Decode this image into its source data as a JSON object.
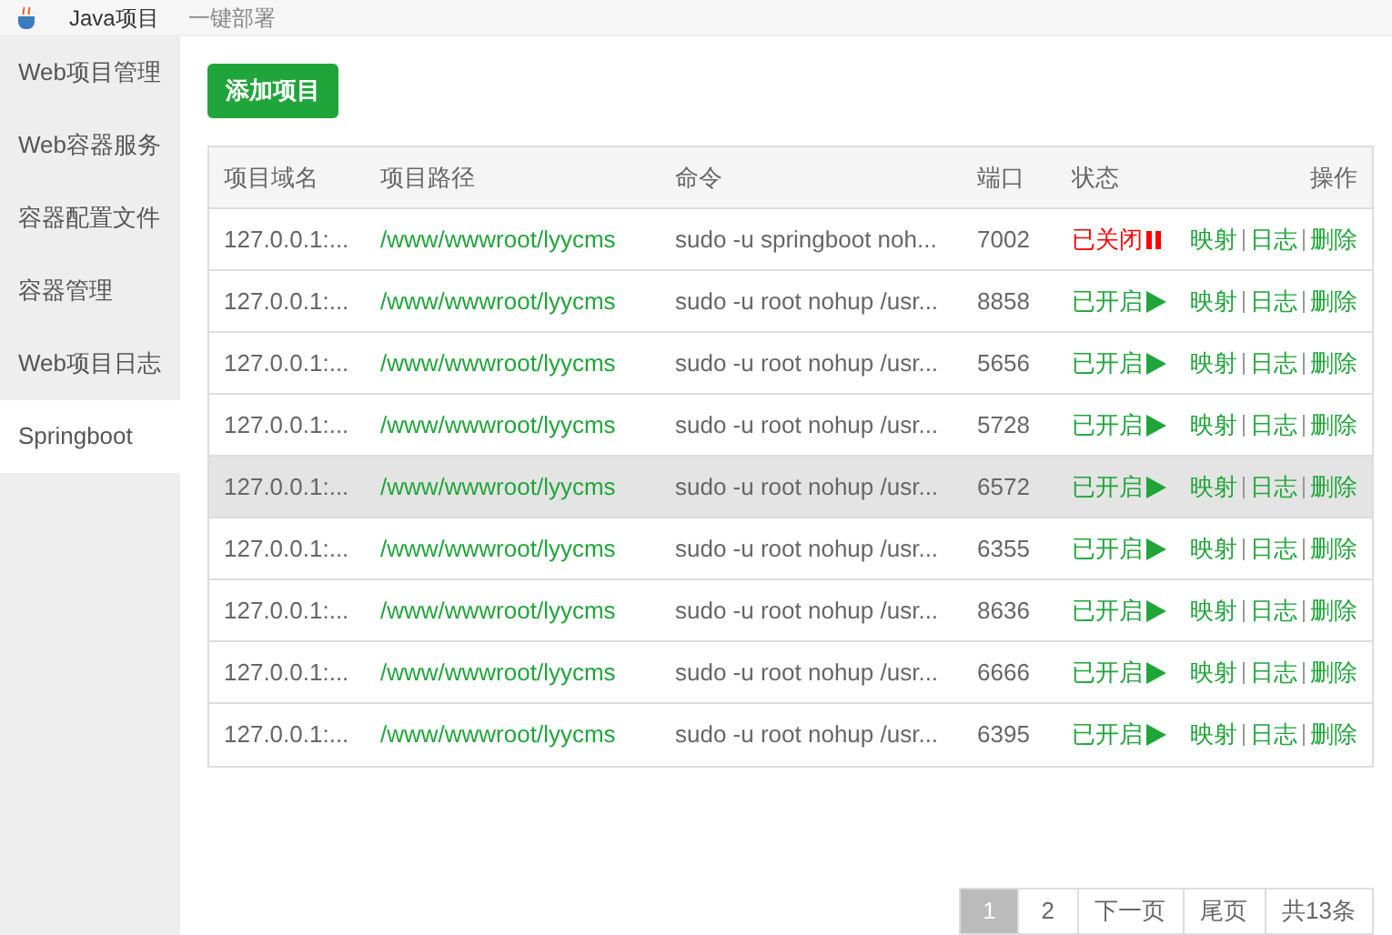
{
  "top_tabs": [
    {
      "label": "Java项目",
      "selected": true
    },
    {
      "label": "一键部署",
      "selected": false
    }
  ],
  "sidebar": {
    "items": [
      {
        "label": "Web项目管理",
        "selected": false
      },
      {
        "label": "Web容器服务",
        "selected": false
      },
      {
        "label": "容器配置文件",
        "selected": false
      },
      {
        "label": "容器管理",
        "selected": false
      },
      {
        "label": "Web项目日志",
        "selected": false
      },
      {
        "label": "Springboot",
        "selected": true
      }
    ]
  },
  "add_button": "添加项目",
  "table": {
    "columns": [
      "项目域名",
      "项目路径",
      "命令",
      "端口",
      "状态",
      "操作"
    ],
    "rows": [
      {
        "domain": "127.0.0.1:...",
        "path": "/www/wwwroot/lyycms",
        "command": "sudo -u springboot noh...",
        "port": "7002",
        "status": "已关闭",
        "running": false,
        "highlighted": false,
        "actions": [
          "映射",
          "日志",
          "删除"
        ]
      },
      {
        "domain": "127.0.0.1:...",
        "path": "/www/wwwroot/lyycms",
        "command": "sudo -u root nohup /usr...",
        "port": "8858",
        "status": "已开启",
        "running": true,
        "highlighted": false,
        "actions": [
          "映射",
          "日志",
          "删除"
        ]
      },
      {
        "domain": "127.0.0.1:...",
        "path": "/www/wwwroot/lyycms",
        "command": "sudo -u root nohup /usr...",
        "port": "5656",
        "status": "已开启",
        "running": true,
        "highlighted": false,
        "actions": [
          "映射",
          "日志",
          "删除"
        ]
      },
      {
        "domain": "127.0.0.1:...",
        "path": "/www/wwwroot/lyycms",
        "command": "sudo -u root nohup /usr...",
        "port": "5728",
        "status": "已开启",
        "running": true,
        "highlighted": false,
        "actions": [
          "映射",
          "日志",
          "删除"
        ]
      },
      {
        "domain": "127.0.0.1:...",
        "path": "/www/wwwroot/lyycms",
        "command": "sudo -u root nohup /usr...",
        "port": "6572",
        "status": "已开启",
        "running": true,
        "highlighted": true,
        "actions": [
          "映射",
          "日志",
          "删除"
        ]
      },
      {
        "domain": "127.0.0.1:...",
        "path": "/www/wwwroot/lyycms",
        "command": "sudo -u root nohup /usr...",
        "port": "6355",
        "status": "已开启",
        "running": true,
        "highlighted": false,
        "actions": [
          "映射",
          "日志",
          "删除"
        ]
      },
      {
        "domain": "127.0.0.1:...",
        "path": "/www/wwwroot/lyycms",
        "command": "sudo -u root nohup /usr...",
        "port": "8636",
        "status": "已开启",
        "running": true,
        "highlighted": false,
        "actions": [
          "映射",
          "日志",
          "删除"
        ]
      },
      {
        "domain": "127.0.0.1:...",
        "path": "/www/wwwroot/lyycms",
        "command": "sudo -u root nohup /usr...",
        "port": "6666",
        "status": "已开启",
        "running": true,
        "highlighted": false,
        "actions": [
          "映射",
          "日志",
          "删除"
        ]
      },
      {
        "domain": "127.0.0.1:...",
        "path": "/www/wwwroot/lyycms",
        "command": "sudo -u root nohup /usr...",
        "port": "6395",
        "status": "已开启",
        "running": true,
        "highlighted": false,
        "actions": [
          "映射",
          "日志",
          "删除"
        ]
      }
    ]
  },
  "pagination": {
    "pages": [
      {
        "label": "1",
        "selected": true
      },
      {
        "label": "2",
        "selected": false
      }
    ],
    "next": "下一页",
    "last": "尾页",
    "total": "共13条"
  }
}
